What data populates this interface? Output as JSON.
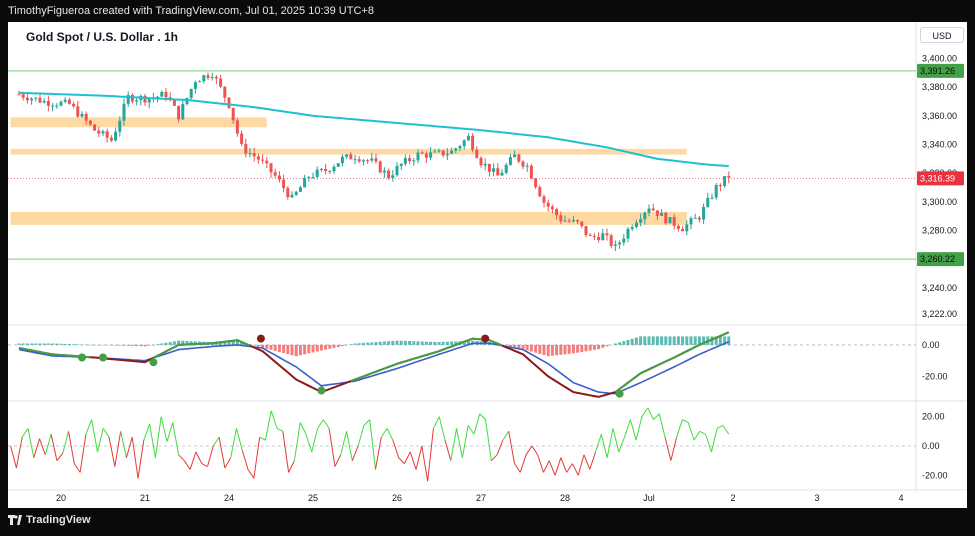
{
  "header": {
    "credit": "TimothyFigueroa created with TradingView.com, Jul 01, 2025 10:39 UTC+8"
  },
  "symbol": {
    "title": "Gold Spot / U.S. Dollar . 1h",
    "currency": "USD"
  },
  "footer": {
    "brand": "TradingView"
  },
  "colors": {
    "up": "#26a69a",
    "down": "#ef5350",
    "ma": "#1fbfcf",
    "zone": "#ffd59a",
    "level": "#7ccf7c",
    "badge_green": "#43a047",
    "badge_red": "#e8333f"
  },
  "chart_data": [
    {
      "type": "candlestick",
      "title": "Gold Spot / U.S. Dollar . 1h",
      "ylim": [
        3215,
        3410
      ],
      "y_ticks": [
        "3,400.00",
        "3,380.00",
        "3,360.00",
        "3,340.00",
        "3,320.00",
        "3,300.00",
        "3,280.00",
        "3,260.00",
        "3,240.00",
        "3,222.00"
      ],
      "y_tick_values": [
        3400,
        3380,
        3360,
        3340,
        3320,
        3300,
        3280,
        3260,
        3240,
        3222
      ],
      "x_labels": [
        "20",
        "21",
        "24",
        "25",
        "26",
        "27",
        "28",
        "Jul",
        "2",
        "3",
        "4"
      ],
      "x_label_positions": [
        0.5,
        1.5,
        2.5,
        3.5,
        4.5,
        5.5,
        6.5,
        7.5,
        8.5,
        9.5,
        10.5
      ],
      "close_path": [
        [
          0.0,
          3375
        ],
        [
          0.3,
          3370
        ],
        [
          0.6,
          3368
        ],
        [
          0.9,
          3350
        ],
        [
          1.1,
          3343
        ],
        [
          1.3,
          3373
        ],
        [
          1.55,
          3372
        ],
        [
          1.75,
          3375
        ],
        [
          1.9,
          3360
        ],
        [
          2.1,
          3385
        ],
        [
          2.3,
          3390
        ],
        [
          2.5,
          3368
        ],
        [
          2.65,
          3338
        ],
        [
          2.85,
          3330
        ],
        [
          3.05,
          3318
        ],
        [
          3.25,
          3302
        ],
        [
          3.45,
          3318
        ],
        [
          3.65,
          3322
        ],
        [
          3.85,
          3330
        ],
        [
          4.0,
          3332
        ],
        [
          4.2,
          3328
        ],
        [
          4.4,
          3318
        ],
        [
          4.55,
          3326
        ],
        [
          4.75,
          3333
        ],
        [
          4.95,
          3333
        ],
        [
          5.15,
          3335
        ],
        [
          5.35,
          3345
        ],
        [
          5.5,
          3328
        ],
        [
          5.7,
          3318
        ],
        [
          5.9,
          3332
        ],
        [
          6.05,
          3325
        ],
        [
          6.25,
          3300
        ],
        [
          6.45,
          3288
        ],
        [
          6.65,
          3285
        ],
        [
          6.8,
          3275
        ],
        [
          6.95,
          3277
        ],
        [
          7.1,
          3268
        ],
        [
          7.3,
          3285
        ],
        [
          7.5,
          3297
        ],
        [
          7.7,
          3288
        ],
        [
          7.9,
          3282
        ],
        [
          8.1,
          3290
        ],
        [
          8.3,
          3310
        ],
        [
          8.45,
          3318
        ]
      ],
      "ma_path": [
        [
          0.0,
          3376
        ],
        [
          1.0,
          3374
        ],
        [
          2.0,
          3371
        ],
        [
          2.8,
          3366
        ],
        [
          3.5,
          3360
        ],
        [
          4.5,
          3355
        ],
        [
          5.5,
          3350
        ],
        [
          6.3,
          3345
        ],
        [
          7.0,
          3338
        ],
        [
          7.6,
          3330
        ],
        [
          8.2,
          3326
        ],
        [
          8.45,
          3325
        ]
      ],
      "zones": [
        [
          -0.1,
          2.95,
          3352,
          3359
        ],
        [
          -0.1,
          7.95,
          3333,
          3337
        ],
        [
          -0.1,
          7.95,
          3284,
          3293
        ]
      ],
      "levels": [
        3391.26,
        3260.22
      ],
      "level_labels": [
        "3,391.26",
        "3,260.22"
      ],
      "last_price": 3316.39,
      "last_price_label": "3,316.39"
    },
    {
      "type": "line",
      "y_ticks": [
        "0.00",
        "-20.00"
      ],
      "y_tick_values": [
        0,
        -20
      ],
      "ylim": [
        -35,
        12
      ],
      "fast": [
        [
          0.0,
          -2
        ],
        [
          0.4,
          -6
        ],
        [
          0.9,
          -8
        ],
        [
          1.5,
          -11
        ],
        [
          1.9,
          0
        ],
        [
          2.3,
          1
        ],
        [
          2.6,
          3
        ],
        [
          2.9,
          -4
        ],
        [
          3.3,
          -22
        ],
        [
          3.6,
          -30
        ],
        [
          4.0,
          -22
        ],
        [
          4.5,
          -12
        ],
        [
          5.0,
          -4
        ],
        [
          5.4,
          4
        ],
        [
          5.6,
          3
        ],
        [
          6.0,
          -6
        ],
        [
          6.3,
          -20
        ],
        [
          6.6,
          -30
        ],
        [
          6.9,
          -33
        ],
        [
          7.1,
          -30
        ],
        [
          7.4,
          -18
        ],
        [
          7.8,
          -8
        ],
        [
          8.1,
          0
        ],
        [
          8.45,
          8
        ]
      ],
      "slow": [
        [
          0.0,
          -3
        ],
        [
          0.4,
          -7
        ],
        [
          0.9,
          -8
        ],
        [
          1.5,
          -10
        ],
        [
          1.9,
          -3
        ],
        [
          2.3,
          -1
        ],
        [
          2.6,
          0
        ],
        [
          2.9,
          -2
        ],
        [
          3.3,
          -14
        ],
        [
          3.6,
          -26
        ],
        [
          4.0,
          -23
        ],
        [
          4.5,
          -15
        ],
        [
          5.0,
          -6
        ],
        [
          5.4,
          1
        ],
        [
          5.6,
          1
        ],
        [
          6.0,
          -3
        ],
        [
          6.3,
          -12
        ],
        [
          6.6,
          -24
        ],
        [
          6.9,
          -30
        ],
        [
          7.1,
          -31
        ],
        [
          7.4,
          -24
        ],
        [
          7.8,
          -14
        ],
        [
          8.1,
          -6
        ],
        [
          8.45,
          2
        ]
      ],
      "cross_points": [
        [
          0.75,
          -8
        ],
        [
          1.0,
          -8
        ],
        [
          1.6,
          -11
        ],
        [
          2.88,
          4
        ],
        [
          3.6,
          -29
        ],
        [
          5.55,
          4
        ],
        [
          7.15,
          -31
        ]
      ],
      "histogram_range": [
        -10,
        10
      ]
    },
    {
      "type": "line",
      "y_ticks": [
        "20.00",
        "0.00",
        "-20.00"
      ],
      "y_tick_values": [
        20,
        0,
        -20
      ],
      "ylim": [
        -30,
        30
      ],
      "values": [
        0,
        -15,
        6,
        12,
        -8,
        5,
        -6,
        8,
        -10,
        -5,
        10,
        -12,
        -18,
        8,
        18,
        -4,
        12,
        6,
        -14,
        10,
        -8,
        6,
        -22,
        4,
        15,
        -8,
        20,
        3,
        16,
        -6,
        -10,
        -16,
        -4,
        -12,
        -14,
        0,
        6,
        -15,
        -8,
        12,
        -3,
        -16,
        -22,
        6,
        4,
        24,
        12,
        10,
        -18,
        -10,
        16,
        8,
        -4,
        12,
        18,
        12,
        -14,
        -6,
        10,
        -10,
        0,
        14,
        18,
        -16,
        6,
        12,
        4,
        -8,
        -12,
        -4,
        -16,
        0,
        -24,
        12,
        20,
        4,
        -10,
        12,
        -8,
        14,
        8,
        22,
        18,
        -10,
        -6,
        4,
        10,
        -12,
        -18,
        -6,
        0,
        -6,
        -18,
        -10,
        -20,
        -8,
        -18,
        -12,
        -20,
        -6,
        -16,
        -4,
        8,
        -8,
        12,
        -4,
        6,
        18,
        4,
        20,
        26,
        18,
        22,
        6,
        -10,
        6,
        18,
        16,
        4,
        10,
        8,
        -4,
        12,
        14,
        8
      ],
      "x_range": [
        -0.1,
        8.45
      ]
    }
  ]
}
